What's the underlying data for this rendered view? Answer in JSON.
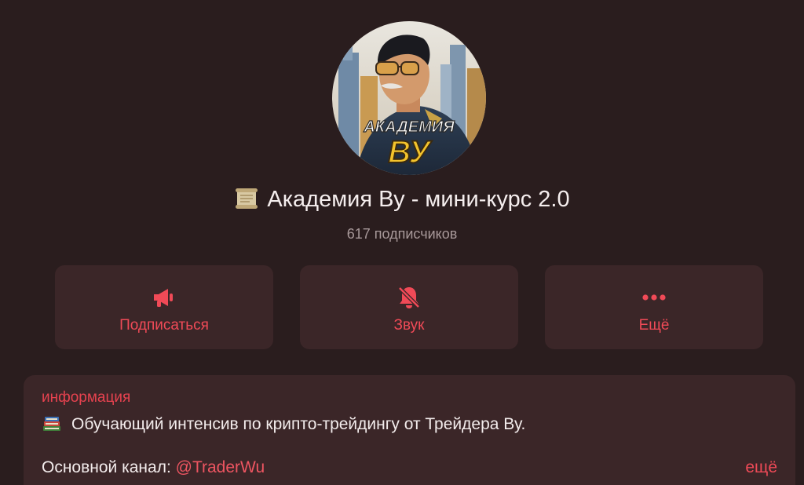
{
  "channel": {
    "avatar_text_top": "АКАДЕМИЯ",
    "avatar_text_bottom": "ВУ",
    "title_icon": "scroll-icon",
    "title": "Академия Ву - мини-курс 2.0",
    "subscribers": "617 подписчиков"
  },
  "actions": [
    {
      "icon": "megaphone-icon",
      "label": "Подписаться"
    },
    {
      "icon": "bell-off-icon",
      "label": "Звук"
    },
    {
      "icon": "more-dots-icon",
      "label": "Ещё"
    }
  ],
  "info": {
    "label": "информация",
    "description_icon": "books-icon",
    "description": "Обучающий интенсив по крипто-трейдингу от Трейдера Ву.",
    "channel_label": "Основной канал: ",
    "channel_link": "@TraderWu",
    "more": "ещё"
  },
  "colors": {
    "background": "#2a1d1e",
    "card": "#3b2628",
    "accent": "#f04a57",
    "muted_text": "#a8999a"
  }
}
